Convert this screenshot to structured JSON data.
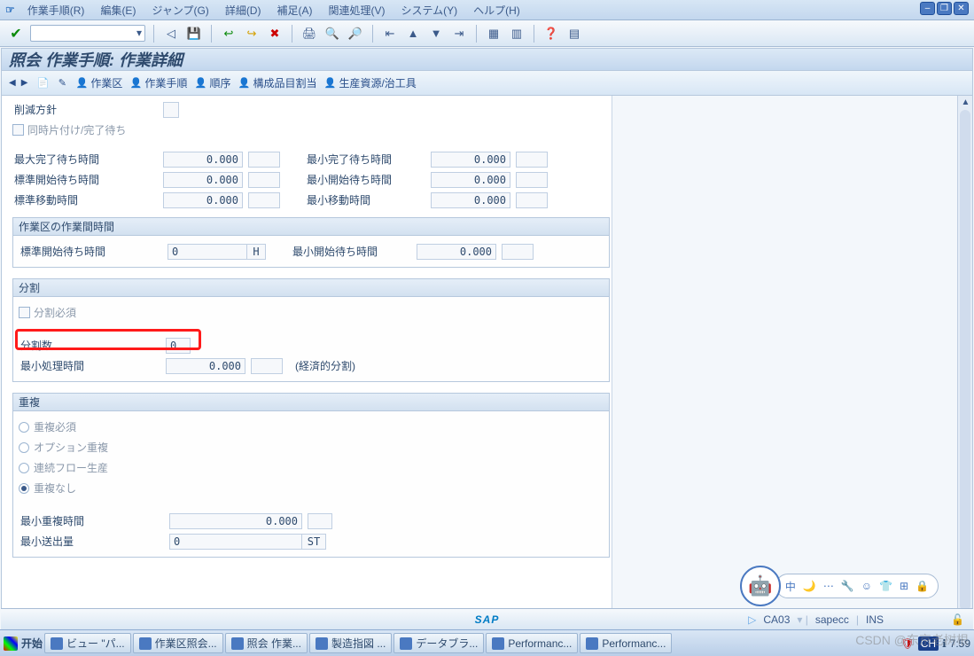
{
  "menu": {
    "items": [
      "作業手順(R)",
      "編集(E)",
      "ジャンプ(G)",
      "詳細(D)",
      "補足(A)",
      "関連処理(V)",
      "システム(Y)",
      "ヘルプ(H)"
    ]
  },
  "title": "照会 作業手順: 作業詳細",
  "appbar": {
    "workarea": "作業区",
    "routing": "作業手順",
    "sequence": "順序",
    "comp": "構成品目割当",
    "prt": "生産資源/治工具"
  },
  "section1": {
    "reduction": "削減方針",
    "simul": "同時片付け/完了待ち",
    "maxwait": "最大完了待ち時間",
    "maxwait_v": "0.000",
    "minwait": "最小完了待ち時間",
    "minwait_v": "0.000",
    "stdstart": "標準開始待ち時間",
    "stdstart_v": "0.000",
    "minstart": "最小開始待ち時間",
    "minstart_v": "0.000",
    "stdmove": "標準移動時間",
    "stdmove_v": "0.000",
    "minmove": "最小移動時間",
    "minmove_v": "0.000"
  },
  "section2": {
    "hdr": "作業区の作業間時間",
    "stdstart": "標準開始待ち時間",
    "stdstart_v": "0",
    "unit": "H",
    "minstart": "最小開始待ち時間",
    "minstart_v": "0.000"
  },
  "section3": {
    "hdr": "分割",
    "req": "分割必須",
    "count": "分割数",
    "count_v": "0",
    "minproc": "最小処理時間",
    "minproc_v": "0.000",
    "econ": "(経済的分割)"
  },
  "section4": {
    "hdr": "重複",
    "r1": "重複必須",
    "r2": "オプション重複",
    "r3": "連続フロー生産",
    "r4": "重複なし",
    "minover": "最小重複時間",
    "minover_v": "0.000",
    "minsend": "最小送出量",
    "minsend_v": "0",
    "unit": "ST"
  },
  "status": {
    "tcode": "CA03",
    "system": "sapecc",
    "mode": "INS"
  },
  "assistant": {
    "lang": "中"
  },
  "taskbar": {
    "start": "开始",
    "items": [
      "ビュー \"パ...",
      "作業区照会...",
      "照会 作業...",
      "製造指図 ...",
      "データブラ...",
      "Performanc...",
      "Performanc..."
    ],
    "time": "7:59"
  },
  "watermark": "CSDN @东京老树根"
}
